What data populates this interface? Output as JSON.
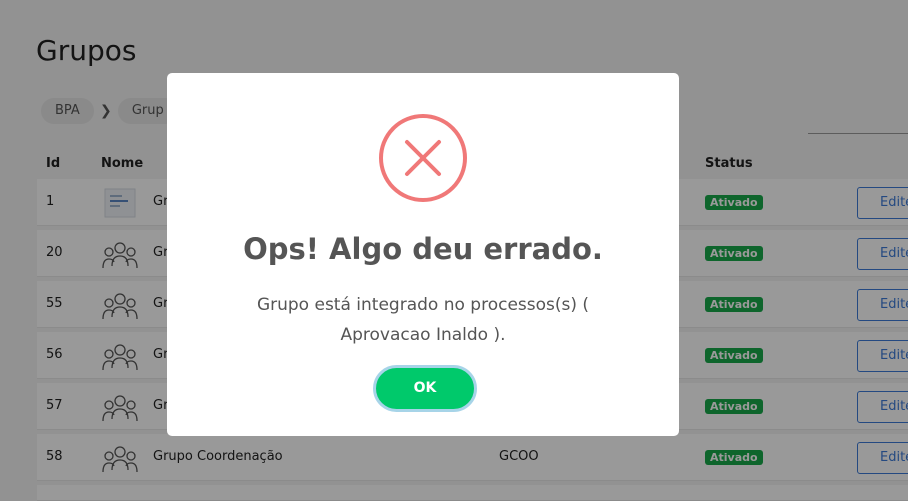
{
  "page": {
    "title": "Grupos"
  },
  "breadcrumb": {
    "items": [
      "BPA",
      "Grup"
    ]
  },
  "table": {
    "headers": {
      "id": "Id",
      "name": "Nome",
      "status": "Status"
    },
    "rows": [
      {
        "id": "1",
        "name": "Gr",
        "sigla": "",
        "status": "Ativado",
        "edit": "Edite"
      },
      {
        "id": "20",
        "name": "Gr",
        "sigla": "",
        "status": "Ativado",
        "edit": "Edite"
      },
      {
        "id": "55",
        "name": "Gr",
        "sigla": "",
        "status": "Ativado",
        "edit": "Edite"
      },
      {
        "id": "56",
        "name": "Gr",
        "sigla": "",
        "status": "Ativado",
        "edit": "Edite"
      },
      {
        "id": "57",
        "name": "Gr",
        "sigla": "",
        "status": "Ativado",
        "edit": "Edite"
      },
      {
        "id": "58",
        "name": "Grupo Coordenação",
        "sigla": "GCOO",
        "status": "Ativado",
        "edit": "Edite"
      }
    ]
  },
  "modal": {
    "icon": "error-x-icon",
    "title": "Ops! Algo deu errado.",
    "message": "Grupo está integrado no processos(s) ( Aprovacao Inaldo ).",
    "ok_label": "OK"
  },
  "colors": {
    "error": "#f07878",
    "ok": "#00c96b",
    "status": "#18a84a",
    "edit": "#3d7bd8"
  }
}
